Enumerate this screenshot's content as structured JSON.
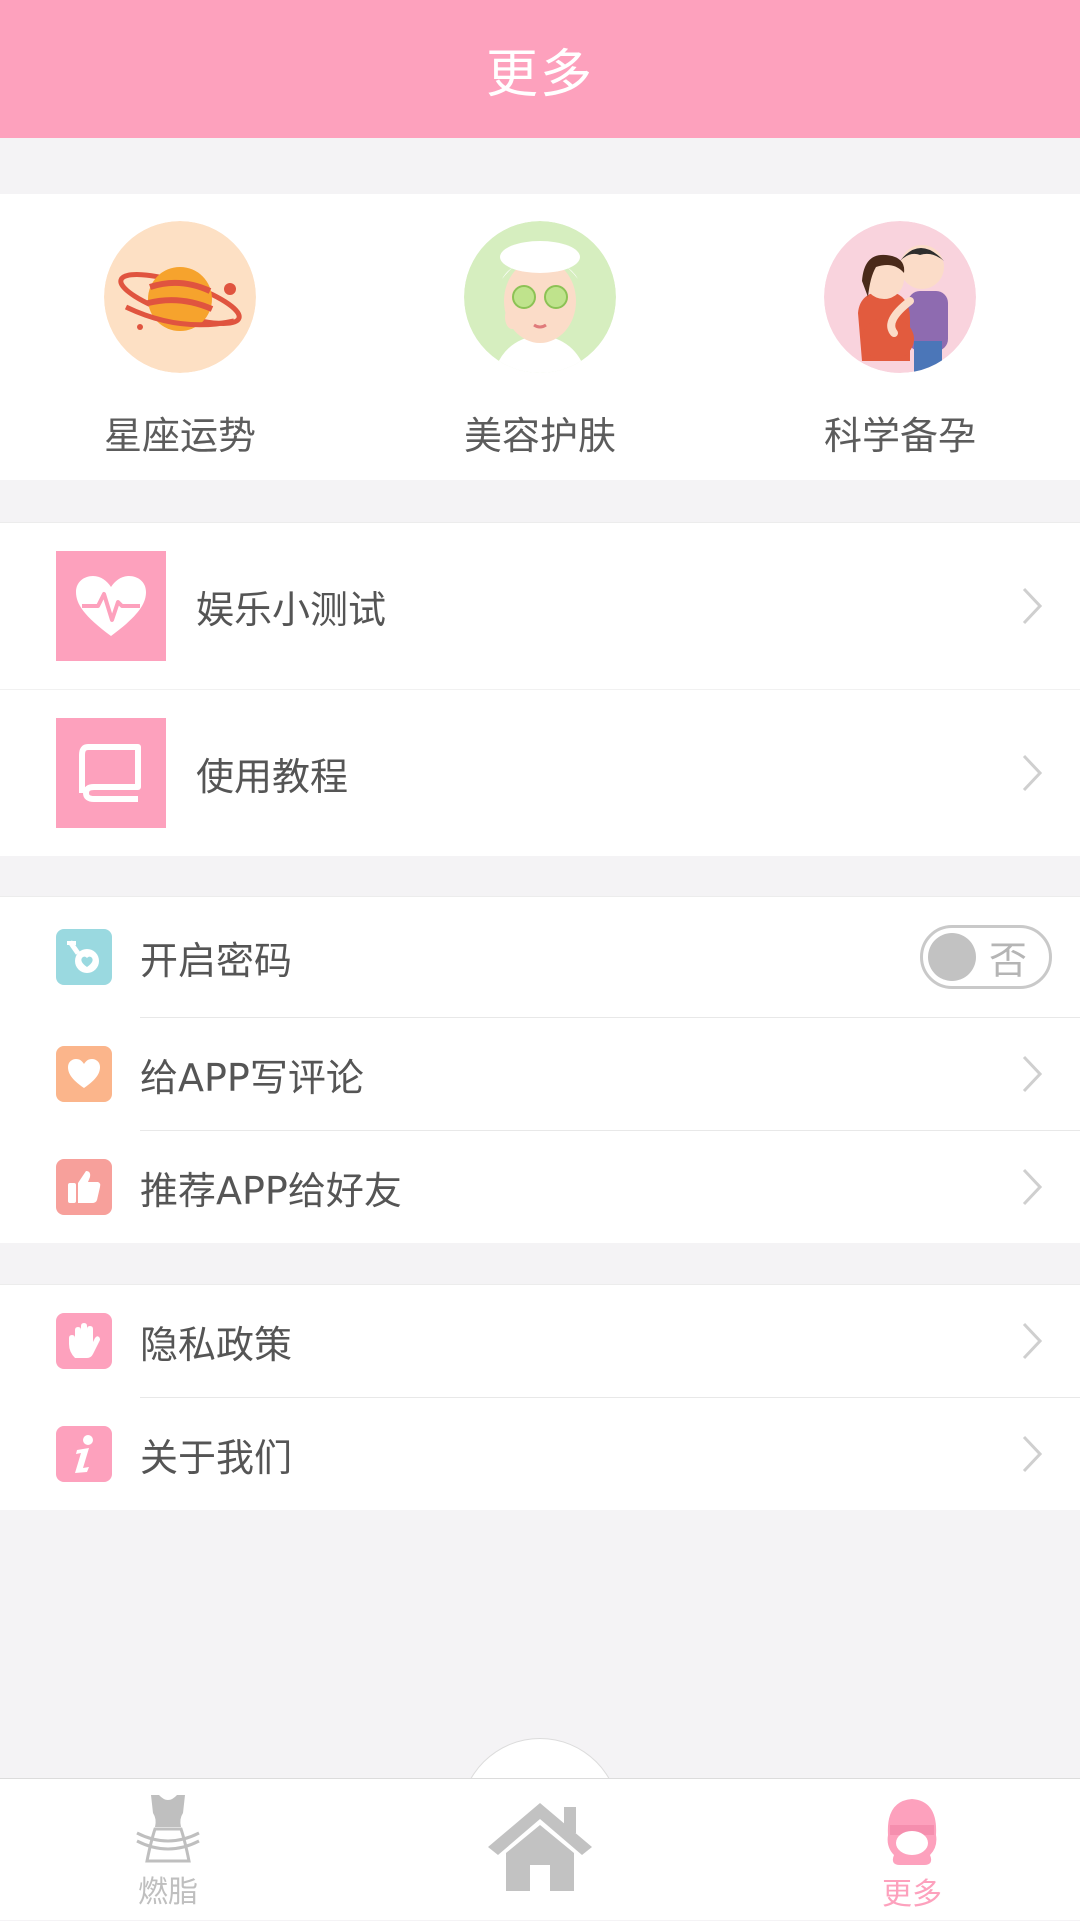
{
  "header": {
    "title": "更多"
  },
  "features": [
    {
      "label": "星座运势",
      "icon": "planet-icon"
    },
    {
      "label": "美容护肤",
      "icon": "face-mask-icon"
    },
    {
      "label": "科学备孕",
      "icon": "couple-icon"
    }
  ],
  "group1": [
    {
      "label": "娱乐小测试",
      "icon": "heartbeat-icon"
    },
    {
      "label": "使用教程",
      "icon": "book-icon"
    }
  ],
  "group2": {
    "password": {
      "label": "开启密码",
      "toggle_text": "否",
      "enabled": false
    },
    "review": {
      "label": "给APP写评论"
    },
    "recommend": {
      "label": "推荐APP给好友"
    }
  },
  "group3": [
    {
      "label": "隐私政策",
      "icon": "hand-icon"
    },
    {
      "label": "关于我们",
      "icon": "info-icon"
    }
  ],
  "tabbar": {
    "left": {
      "label": "燃脂",
      "icon": "slim-body-icon"
    },
    "center": {
      "icon": "home-icon"
    },
    "right": {
      "label": "更多",
      "icon": "girl-icon",
      "active": true
    }
  },
  "colors": {
    "accent": "#fda1bd",
    "cyan": "#9ad9e0",
    "orange": "#fbb58b",
    "red": "#f7a09b",
    "inactive": "#bfbfbf"
  }
}
